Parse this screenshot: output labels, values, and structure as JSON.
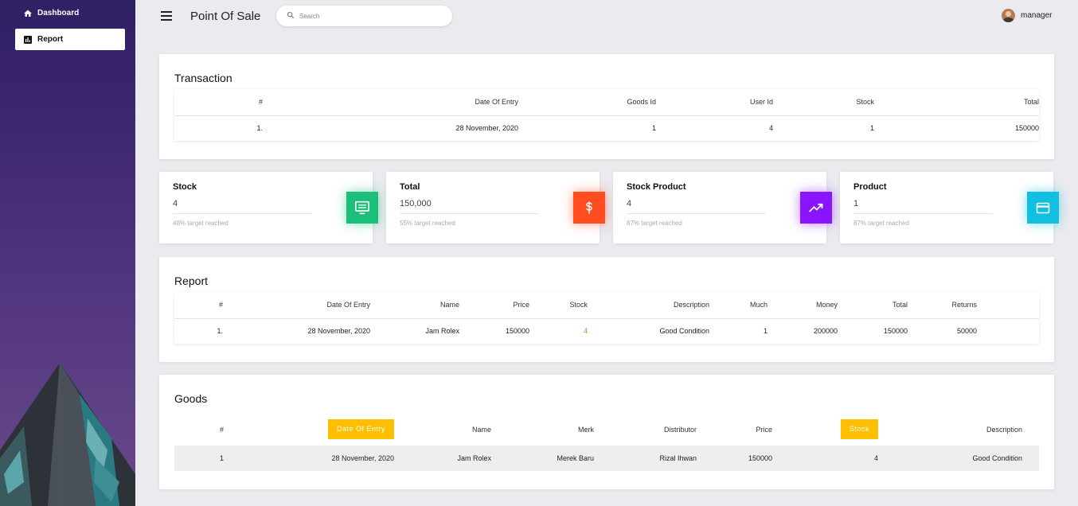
{
  "sidebar": {
    "items": [
      {
        "label": "Dashboard",
        "icon": "home-icon"
      },
      {
        "label": "Report",
        "icon": "bar-chart-icon"
      }
    ]
  },
  "topbar": {
    "title": "Point Of Sale",
    "search_placeholder": "Search",
    "user_name": "manager"
  },
  "transaction": {
    "title": "Transaction",
    "headers": [
      "#",
      "Date Of Entry",
      "Goods Id",
      "User Id",
      "Stock",
      "Total"
    ],
    "rows": [
      [
        "1.",
        "28 November, 2020",
        "1",
        "4",
        "1",
        "150000"
      ]
    ]
  },
  "stats": [
    {
      "label": "Stock",
      "value": "4",
      "note": "48% target reached",
      "color": "#1bbf7a",
      "icon": "monitor-icon"
    },
    {
      "label": "Total",
      "value": "150,000",
      "note": "55% target reached",
      "color": "#ff4d1f",
      "icon": "dollar-icon"
    },
    {
      "label": "Stock Product",
      "value": "4",
      "note": "87% target reached",
      "color": "#8a14ff",
      "icon": "trending-up-icon"
    },
    {
      "label": "Product",
      "value": "1",
      "note": "87% target reached",
      "color": "#12bfe0",
      "icon": "credit-card-icon"
    }
  ],
  "report": {
    "title": "Report",
    "headers": [
      "#",
      "Date Of Entry",
      "Name",
      "Price",
      "Stock",
      "Description",
      "Much",
      "Money",
      "Total",
      "Returns"
    ],
    "rows": [
      [
        "1.",
        "28 November, 2020",
        "Jam Rolex",
        "150000",
        "4",
        "Good Condition",
        "1",
        "200000",
        "150000",
        "50000"
      ]
    ]
  },
  "goods": {
    "title": "Goods",
    "headers": [
      "#",
      "Date Of Entry",
      "Name",
      "Merk",
      "Distributor",
      "Price",
      "Stock",
      "Description"
    ],
    "rows": [
      [
        "1",
        "28 November, 2020",
        "Jam Rolex",
        "Merek Baru",
        "Rizal Ihwan",
        "150000",
        "4",
        "Good Condition"
      ]
    ]
  },
  "colors": {
    "sidebar_top": "#2f1f63",
    "badge": "#ffbf00",
    "report_stock_value": "#d38a00"
  }
}
